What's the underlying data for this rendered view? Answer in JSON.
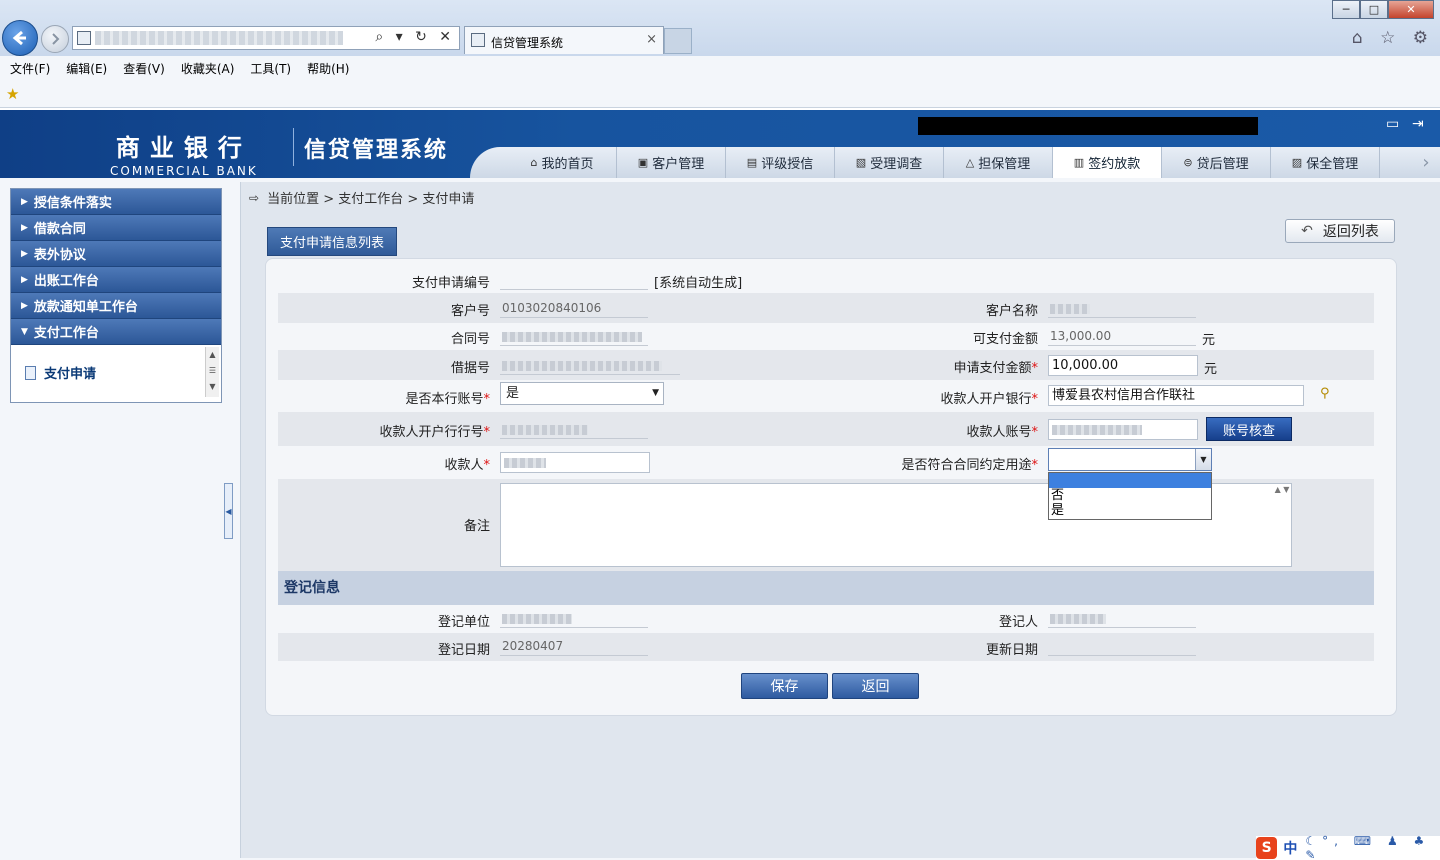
{
  "browser": {
    "tab_title": "信贷管理系统",
    "tab_close": "×",
    "menu": [
      "文件(F)",
      "编辑(E)",
      "查看(V)",
      "收藏夹(A)",
      "工具(T)",
      "帮助(H)"
    ],
    "window_controls": {
      "minimize": "─",
      "maximize": "□",
      "close": "✕"
    },
    "address_tools": "⌕ ▾ ↻ ✕",
    "chrome_icons": "⌂ ☆ ⚙",
    "fav_icon": "★"
  },
  "header": {
    "brand_cn": "商业银行",
    "brand_en": "COMMERCIAL BANK",
    "system_title": "信贷管理系统",
    "icon_monitor": "▭",
    "icon_exit": "⇥",
    "nav_next": "›",
    "nav": [
      {
        "label": "我的首页",
        "icon": "⌂"
      },
      {
        "label": "客户管理",
        "icon": "▣"
      },
      {
        "label": "评级授信",
        "icon": "▤"
      },
      {
        "label": "受理调查",
        "icon": "▧"
      },
      {
        "label": "担保管理",
        "icon": "△"
      },
      {
        "label": "签约放款",
        "icon": "▥"
      },
      {
        "label": "贷后管理",
        "icon": "⊜"
      },
      {
        "label": "保全管理",
        "icon": "▨"
      }
    ],
    "active_nav": 5
  },
  "sidebar": {
    "items": [
      "授信条件落实",
      "借款合同",
      "表外协议",
      "出账工作台",
      "放款通知单工作台",
      "支付工作台"
    ],
    "expanded_index": 5,
    "arrow_collapsed": "▶",
    "arrow_expanded": "▼",
    "sub_item": "支付申请",
    "scroll_glyphs": "▲ ☰ ▼"
  },
  "breadcrumb": {
    "icon": "⇨",
    "text": "当前位置 > 支付工作台 > 支付申请"
  },
  "list_tab": "支付申请信息列表",
  "back_list": {
    "icon": "↶",
    "label": "返回列表"
  },
  "form": {
    "apply_no": {
      "label": "支付申请编号",
      "hint": "[系统自动生成]"
    },
    "customer_no": {
      "label": "客户号",
      "value": "0103020840106"
    },
    "customer_name": {
      "label": "客户名称"
    },
    "contract_no": {
      "label": "合同号"
    },
    "payable_amount": {
      "label": "可支付金额",
      "value": "13,000.00",
      "unit": "元"
    },
    "loan_no": {
      "label": "借据号"
    },
    "apply_amount": {
      "label": "申请支付金额",
      "value": "10,000.00",
      "unit": "元"
    },
    "own_bank_account": {
      "label": "是否本行账号",
      "value": "是",
      "arrow": "▼"
    },
    "payee_bank": {
      "label": "收款人开户银行",
      "value": "博爱县农村信用合作联社",
      "icon": "⚲"
    },
    "payee_bank_code": {
      "label": "收款人开户行行号"
    },
    "payee_account": {
      "label": "收款人账号",
      "button": "账号核查"
    },
    "payee": {
      "label": "收款人"
    },
    "purpose_match": {
      "label": "是否符合合同约定用途",
      "options": [
        "否",
        "是"
      ],
      "arrow": "▼"
    },
    "remark": {
      "label": "备注",
      "scroll": "▲ ▼"
    },
    "required_mark": "*"
  },
  "register": {
    "section_title": "登记信息",
    "unit": {
      "label": "登记单位"
    },
    "person": {
      "label": "登记人"
    },
    "date": {
      "label": "登记日期",
      "value": "20280407"
    },
    "update_date": {
      "label": "更新日期"
    }
  },
  "buttons": {
    "save": "保存",
    "return": "返回"
  },
  "collapse_arrow": "◀",
  "ime": {
    "logo": "S",
    "mode": "中",
    "rest": "☾°, ⌨ ♟ ♣ ✎"
  }
}
